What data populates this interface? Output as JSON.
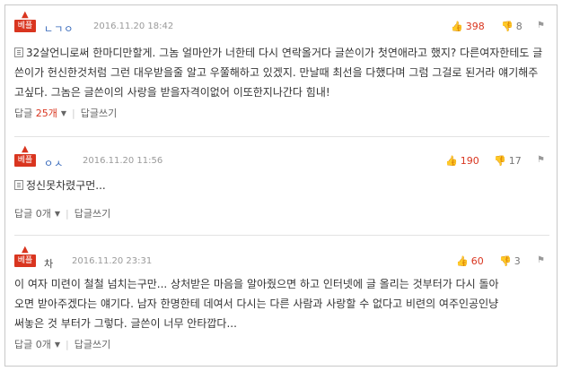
{
  "comments": [
    {
      "badge": "베플",
      "nickname": "ㄴㄱㅇ",
      "date": "2016.11.20 18:42",
      "upvotes": "398",
      "downvotes": "8",
      "text": "32살언니로써 한마디만할게. 그놈 얼마안가 너한테 다시 연락올거다 글쓴이가 첫연애라고 했지? 다른여자한테도 글쓴이가 헌신한것처럼 그런 대우받을줄 알고 우쭐해하고 있겠지. 만날때 최선을 다했다며 그럼 그걸로 된거라 얘기해주고싶다. 그놈은 글쓴이의 사랑을 받을자격이없어 이또한지나간다 힘내!",
      "reply_label": "답글",
      "reply_count": "25개",
      "write_reply": "답글쓰기"
    },
    {
      "badge": "베플",
      "nickname": "ㅇㅅ",
      "date": "2016.11.20 11:56",
      "upvotes": "190",
      "downvotes": "17",
      "text": "정신못차렸구먼...",
      "reply_label": "답글",
      "reply_count": "0개",
      "write_reply": "답글쓰기"
    },
    {
      "badge": "베플",
      "nickname": "차",
      "date": "2016.11.20 23:31",
      "upvotes": "60",
      "downvotes": "3",
      "text_lines": [
        "이 여자 미련이 철철 넘치는구만... 상처받은 마음을 알아줬으면 하고 인터넷에 글 올리는 것부터가 다시 돌아",
        "오면 받아주겠다는 얘기다. 남자 한명한테 데여서 다시는 다른 사람과 사랑할 수 없다고 비련의 여주인공인냥",
        "써놓은 것 부터가 그렇다. 글쓴이 너무 안타깝다..."
      ],
      "reply_label": "답글",
      "reply_count": "0개",
      "write_reply": "답글쓰기"
    }
  ],
  "icons": {
    "thumb": "thumbs-up-icon",
    "thumb_down": "thumbs-down-icon",
    "report": "report-flag-icon",
    "doc": "document-icon",
    "caret": "caret-down-icon"
  },
  "colors": {
    "accent": "#d9351f",
    "nickname": "#2f63b8",
    "muted": "#9a9a9a"
  }
}
